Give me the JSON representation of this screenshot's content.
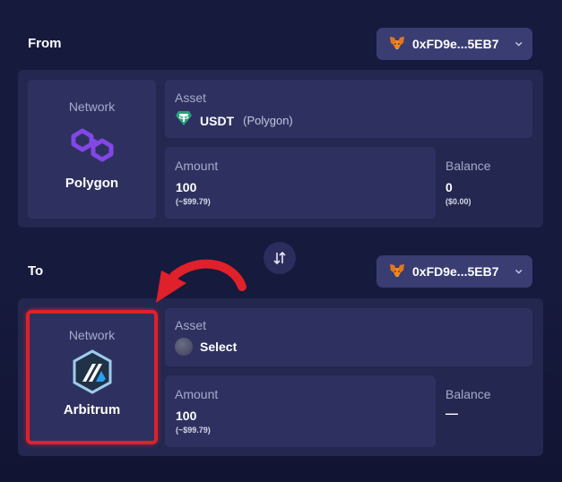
{
  "from": {
    "section_label": "From",
    "wallet": {
      "address": "0xFD9e...5EB7",
      "icon": "metamask-fox-icon"
    },
    "network": {
      "label": "Network",
      "name": "Polygon",
      "icon": "polygon-icon"
    },
    "asset": {
      "label": "Asset",
      "symbol": "USDT",
      "chain": "(Polygon)",
      "icon": "tether-icon"
    },
    "amount": {
      "label": "Amount",
      "value": "100",
      "usd": "(~$99.79)"
    },
    "balance": {
      "label": "Balance",
      "value": "0",
      "usd": "($0.00)"
    }
  },
  "swap_icon": "swap-arrows-icon",
  "to": {
    "section_label": "To",
    "wallet": {
      "address": "0xFD9e...5EB7",
      "icon": "metamask-fox-icon"
    },
    "network": {
      "label": "Network",
      "name": "Arbitrum",
      "icon": "arbitrum-icon"
    },
    "asset": {
      "label": "Asset",
      "value": "Select",
      "icon": "placeholder-token-icon"
    },
    "amount": {
      "label": "Amount",
      "value": "100",
      "usd": "(~$99.79)"
    },
    "balance": {
      "label": "Balance",
      "value": "—"
    }
  },
  "colors": {
    "background": "#161a3d",
    "panel": "#24274f",
    "card": "#2e3160",
    "wallet_button": "#3a3d72",
    "polygon": "#8247e5",
    "tether": "#26a17b",
    "annotation": "#e0202a"
  }
}
